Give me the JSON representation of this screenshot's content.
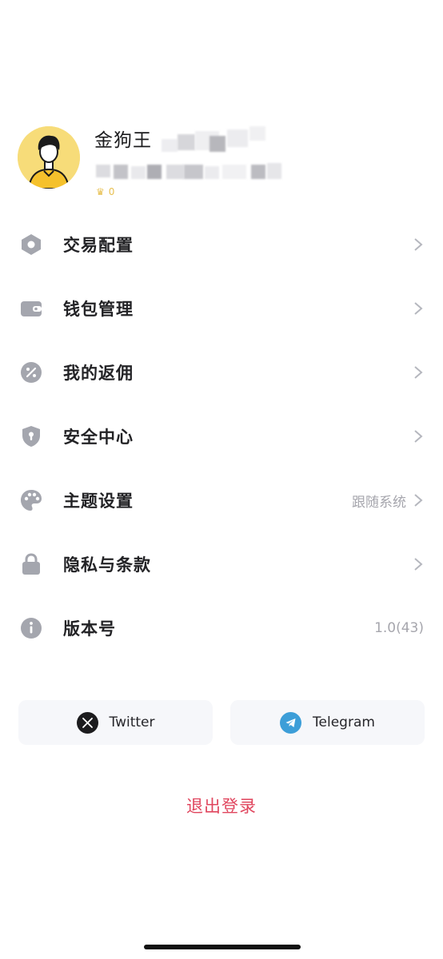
{
  "profile": {
    "username": "金狗王",
    "vip_level": "0"
  },
  "menu": {
    "items": [
      {
        "id": "trade-config",
        "label": "交易配置",
        "icon": "hexagon-icon",
        "value": ""
      },
      {
        "id": "wallet",
        "label": "钱包管理",
        "icon": "wallet-icon",
        "value": ""
      },
      {
        "id": "rebate",
        "label": "我的返佣",
        "icon": "percent-icon",
        "value": ""
      },
      {
        "id": "security",
        "label": "安全中心",
        "icon": "shield-icon",
        "value": ""
      },
      {
        "id": "theme",
        "label": "主题设置",
        "icon": "palette-icon",
        "value": "跟随系统"
      },
      {
        "id": "privacy",
        "label": "隐私与条款",
        "icon": "lock-icon",
        "value": ""
      },
      {
        "id": "version",
        "label": "版本号",
        "icon": "info-icon",
        "value": "1.0(43)"
      }
    ]
  },
  "social": {
    "twitter_label": "Twitter",
    "telegram_label": "Telegram"
  },
  "logout_label": "退出登录",
  "colors": {
    "icon_gray": "#a4a6ae",
    "logout_red": "#e0465e",
    "avatar_yellow": "#f7dc79",
    "telegram_blue": "#3d9ed8"
  }
}
